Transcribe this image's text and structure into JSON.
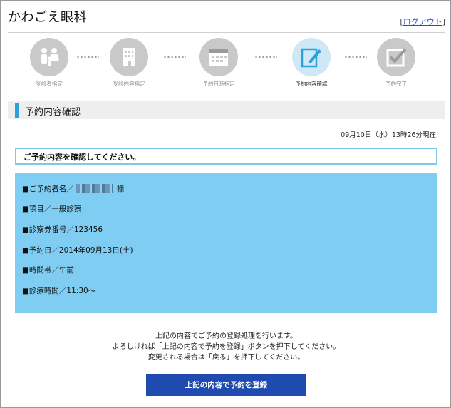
{
  "header": {
    "clinic_name": "かわごえ眼科",
    "logout_label": "ログアウト"
  },
  "steps": [
    {
      "label": "受診者指定",
      "icon": "family-icon",
      "state": "done"
    },
    {
      "label": "受診内容指定",
      "icon": "hospital-icon",
      "state": "done"
    },
    {
      "label": "予約日時指定",
      "icon": "calendar-icon",
      "state": "done"
    },
    {
      "label": "予約内容確認",
      "icon": "edit-icon",
      "state": "active"
    },
    {
      "label": "予約完了",
      "icon": "checkbox-icon",
      "state": "todo"
    }
  ],
  "section": {
    "title": "予約内容確認"
  },
  "timestamp": "09月10日（水）13時26分現在",
  "notice": "ご予約内容を確認してください。",
  "details": {
    "reserver_prefix": "■ご予約者名／",
    "reserver_suffix": "様",
    "item": "■項目／一般診察",
    "card_number": "■診察券番号／123456",
    "date": "■予約日／2014年09月13日(土)",
    "time_slot": "■時間帯／午前",
    "time": "■診療時間／11:30～"
  },
  "guide": {
    "line1": "上記の内容でご予約の登録処理を行います。",
    "line2": "よろしければ「上記の内容で予約を登録」ボタンを押下してください。",
    "line3": "変更される場合は「戻る」を押下してください。"
  },
  "submit_label": "上記の内容で予約を登録",
  "colors": {
    "accent_bar": "#2aa0dc",
    "details_bg": "#7fcdf2",
    "notice_border": "#80c8ea",
    "button": "#1f4bb0",
    "active_step": "#cfe8f6"
  }
}
